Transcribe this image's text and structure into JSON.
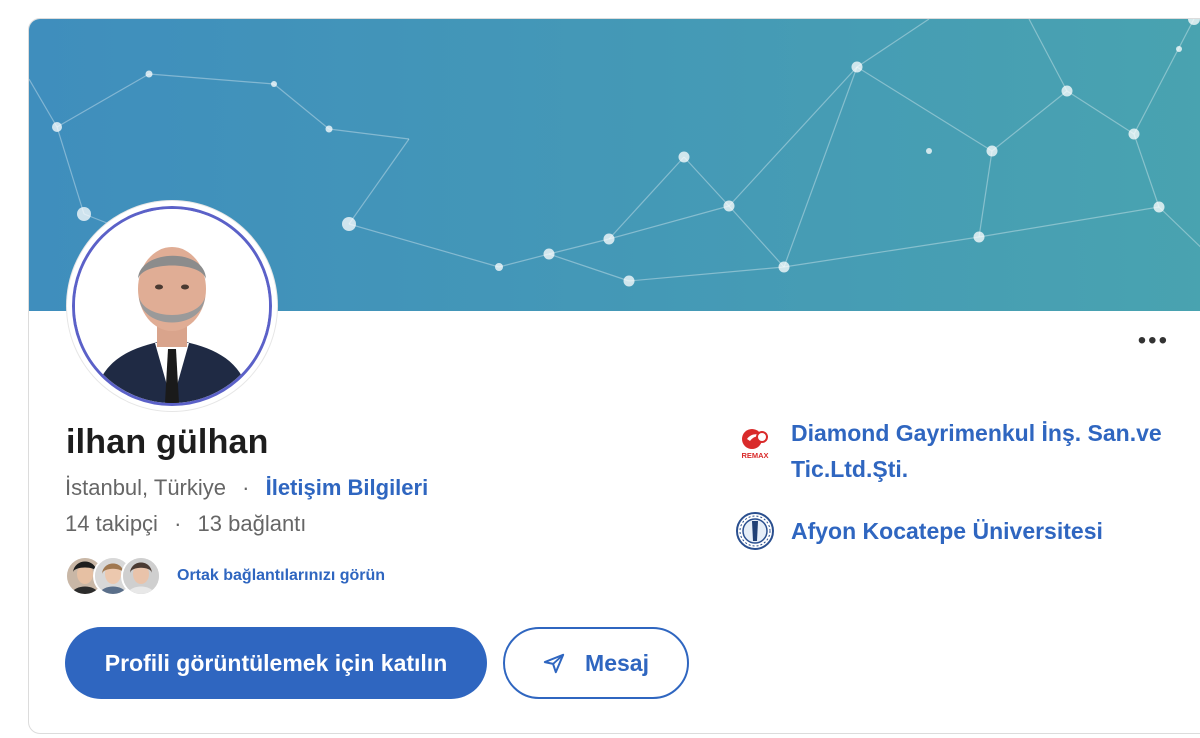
{
  "profile": {
    "name": "ilhan gülhan",
    "location": "İstanbul, Türkiye",
    "contact_link": "İletişim Bilgileri",
    "followers": "14 takipçi",
    "connections": "13 bağlantı",
    "mutual_link": "Ortak bağlantılarınızı görün"
  },
  "actions": {
    "join_label": "Profili görüntülemek için katılın",
    "message_label": "Mesaj",
    "more_label": "•••"
  },
  "experience": [
    {
      "name": "Diamond Gayrimenkul İnş. San.ve Tic.Ltd.Şti.",
      "logo": "remax-logo",
      "logo_text": "REMAX"
    },
    {
      "name": "Afyon Kocatepe Üniversitesi",
      "logo": "university-seal-logo"
    }
  ],
  "colors": {
    "accent": "#2f66c0",
    "cover_start": "#3f8ebd",
    "cover_end": "#49a3b0",
    "avatar_ring": "#5b61c8"
  }
}
